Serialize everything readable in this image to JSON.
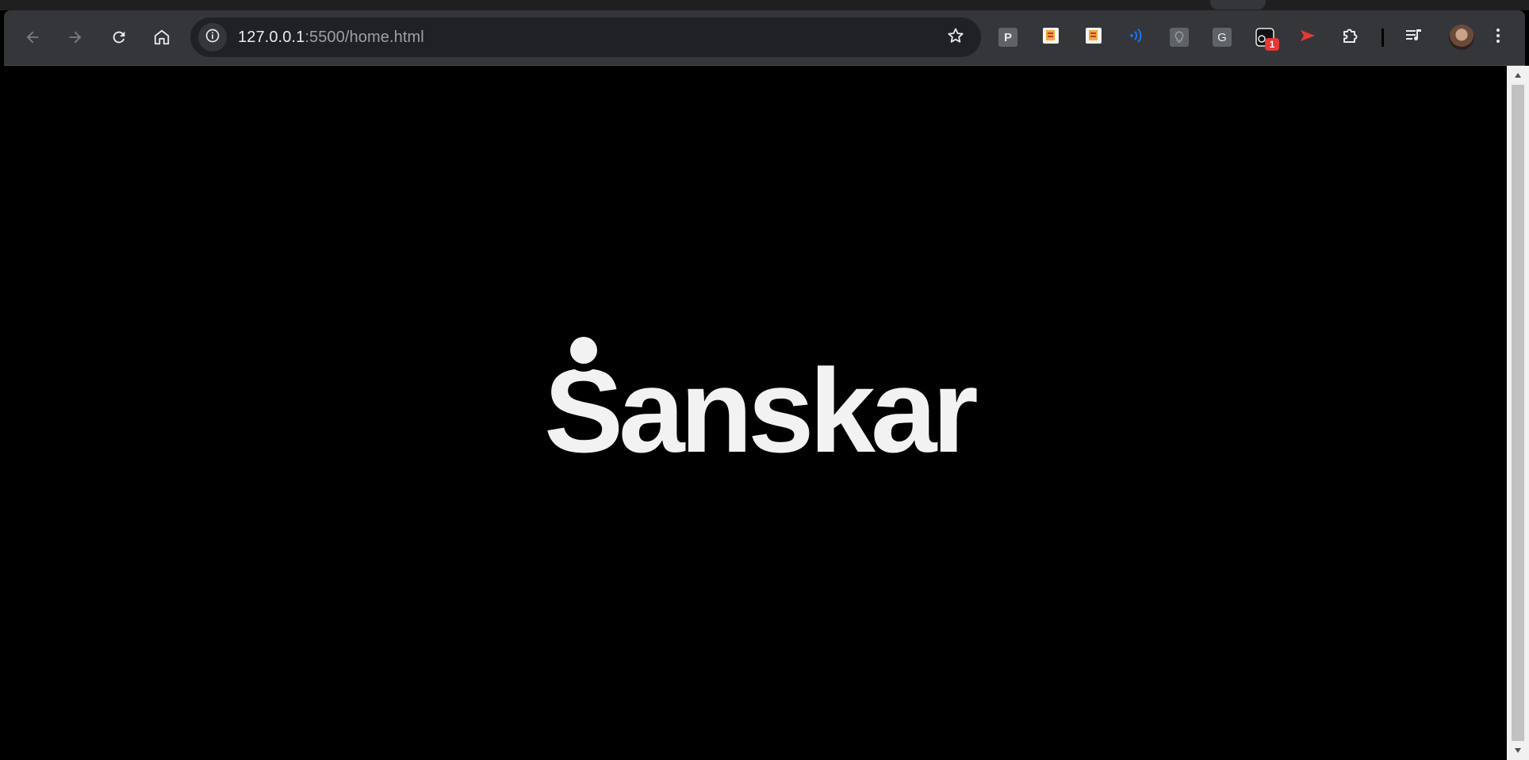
{
  "browser": {
    "url_host": "127.0.0.1",
    "url_rest": ":5500/home.html",
    "icons": {
      "back": "arrow-left-icon",
      "forward": "arrow-right-icon",
      "reload": "reload-icon",
      "home": "home-icon",
      "site_info": "info-icon",
      "bookmark": "star-icon",
      "extensions": "puzzle-icon",
      "media": "playlist-icon",
      "menu": "kebab-menu-icon"
    },
    "extensions": [
      {
        "name": "ext-p",
        "label": "P"
      },
      {
        "name": "ext-notes-1",
        "label": ""
      },
      {
        "name": "ext-notes-2",
        "label": ""
      },
      {
        "name": "ext-audio",
        "label": ""
      },
      {
        "name": "ext-bulb",
        "label": ""
      },
      {
        "name": "ext-g",
        "label": "G"
      },
      {
        "name": "ext-badge",
        "label": "",
        "badge": "1"
      },
      {
        "name": "ext-play",
        "label": ""
      }
    ],
    "colors": {
      "toolbar": "#35363a",
      "omnibox": "#202124",
      "badge": "#e53935",
      "play": "#e53935",
      "audio": "#1a73e8"
    }
  },
  "page": {
    "logo_text": "Sanskar",
    "background": "#000000",
    "logo_color": "#f2f2f2"
  }
}
